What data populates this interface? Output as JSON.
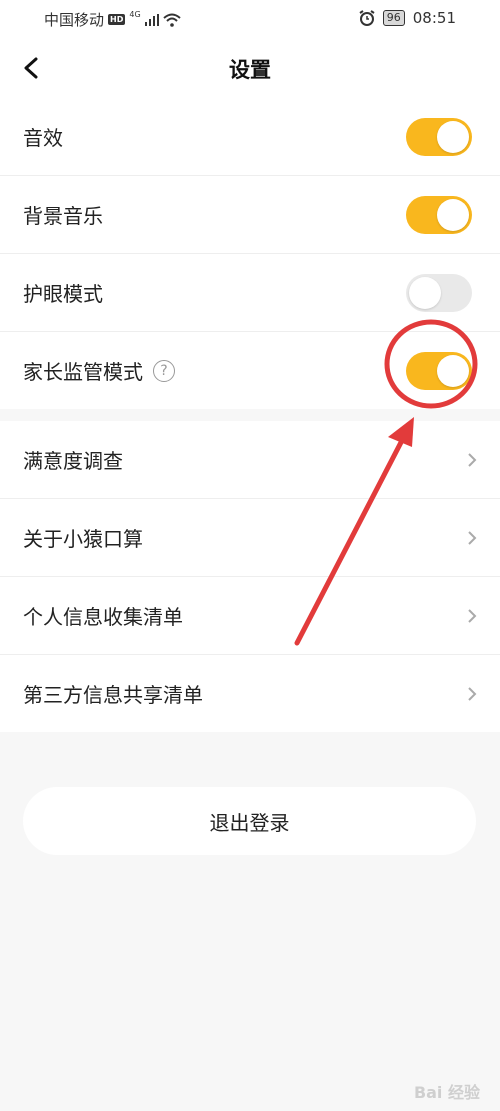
{
  "status_bar": {
    "carrier": "中国移动",
    "hd": "HD",
    "network": "4G",
    "battery": "96",
    "time": "08:51"
  },
  "nav": {
    "title": "设置"
  },
  "toggles": [
    {
      "label": "音效",
      "state": "on"
    },
    {
      "label": "背景音乐",
      "state": "on"
    },
    {
      "label": "护眼模式",
      "state": "off"
    },
    {
      "label": "家长监管模式",
      "state": "on",
      "has_help": true
    }
  ],
  "links": [
    {
      "label": "满意度调查"
    },
    {
      "label": "关于小猿口算"
    },
    {
      "label": "个人信息收集清单"
    },
    {
      "label": "第三方信息共享清单"
    }
  ],
  "logout_label": "退出登录",
  "help_glyph": "?",
  "watermark": "Bai 经验",
  "colors": {
    "toggle_on": "#f9b71e",
    "toggle_off": "#e9e9e9",
    "annotation": "#e23b3b"
  }
}
